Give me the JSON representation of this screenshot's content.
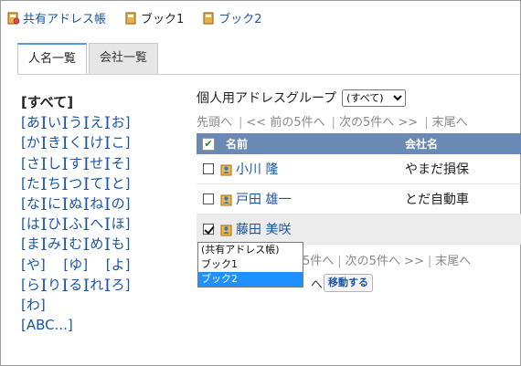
{
  "bookbar": {
    "items": [
      {
        "label": "共有アドレス帳",
        "link": true,
        "icon": "shared-book-icon"
      },
      {
        "label": "ブック1",
        "link": false,
        "icon": "book-icon"
      },
      {
        "label": "ブック2",
        "link": true,
        "icon": "book-icon"
      }
    ]
  },
  "tabs": [
    {
      "label": "人名一覧",
      "active": true
    },
    {
      "label": "会社一覧",
      "active": false
    }
  ],
  "kana": {
    "all": "[すべて]",
    "rows": [
      [
        "[あ]",
        "[い]",
        "[う]",
        "[え]",
        "[お]"
      ],
      [
        "[か]",
        "[き]",
        "[く]",
        "[け]",
        "[こ]"
      ],
      [
        "[さ]",
        "[し]",
        "[す]",
        "[せ]",
        "[そ]"
      ],
      [
        "[た]",
        "[ち]",
        "[つ]",
        "[て]",
        "[と]"
      ],
      [
        "[な]",
        "[に]",
        "[ぬ]",
        "[ね]",
        "[の]"
      ],
      [
        "[は]",
        "[ひ]",
        "[ふ]",
        "[へ]",
        "[ほ]"
      ],
      [
        "[ま]",
        "[み]",
        "[む]",
        "[め]",
        "[も]"
      ],
      [
        "[や]",
        "",
        "[ゆ]",
        "",
        "[よ]"
      ],
      [
        "[ら]",
        "[り]",
        "[る]",
        "[れ]",
        "[ろ]"
      ],
      [
        "[わ]"
      ],
      [
        "[ABC...]"
      ]
    ]
  },
  "group": {
    "label": "個人用アドレスグループ",
    "select_value": "(すべて)"
  },
  "pager": {
    "first": "先頭へ",
    "prev": "<< 前の5件へ",
    "next": "次の5件へ >>",
    "last": "末尾へ"
  },
  "table": {
    "col_name": "名前",
    "col_company": "会社名",
    "rows": [
      {
        "name": "小川 隆",
        "company": "やまだ損保",
        "checked": false
      },
      {
        "name": "戸田 雄一",
        "company": "とだ自動車",
        "checked": false
      },
      {
        "name": "藤田 美咲",
        "company": "",
        "checked": true
      }
    ]
  },
  "pager2": {
    "prev_partial": "5件へ",
    "next": "次の5件へ >>",
    "last": "末尾へ"
  },
  "move": {
    "options": [
      "(共有アドレス帳)",
      "ブック1",
      "ブック2"
    ],
    "highlighted_index": 2,
    "tail": "へ",
    "button": "移動する"
  },
  "colors": {
    "link": "#1a55a8",
    "header_bg": "#6a89b4",
    "highlight": "#1e90ff",
    "tab_accent": "#5b9bd5"
  }
}
